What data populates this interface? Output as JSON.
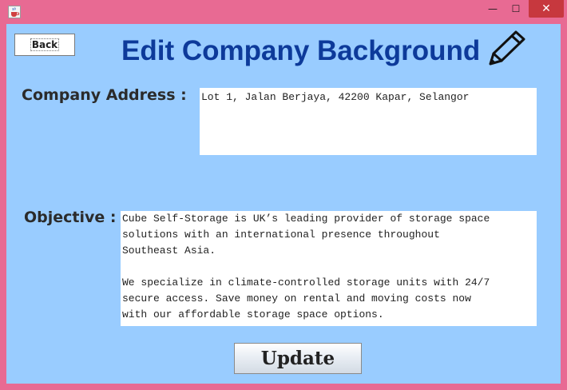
{
  "window": {
    "minimize_symbol": "—",
    "maximize_symbol": "☐",
    "close_symbol": "✕",
    "app_icon": "java-cup-icon"
  },
  "header": {
    "back_label": "Back",
    "title": "Edit Company Background",
    "title_icon": "pencil-icon"
  },
  "form": {
    "address_label": "Company Address :",
    "address_value": "Lot 1, Jalan Berjaya, 42200 Kapar, Selangor",
    "objective_label": "Objective :",
    "objective_value": "Cube Self-Storage is UK’s leading provider of storage space\nsolutions with an international presence throughout\nSoutheast Asia.\n\nWe specialize in climate-controlled storage units with 24/7\nsecure access. Save money on rental and moving costs now\nwith our affordable storage space options.",
    "update_label": "Update"
  },
  "colors": {
    "frame": "#e86a93",
    "panel": "#99ccff",
    "title_text": "#0d3a9a",
    "close_button": "#c7383e"
  }
}
